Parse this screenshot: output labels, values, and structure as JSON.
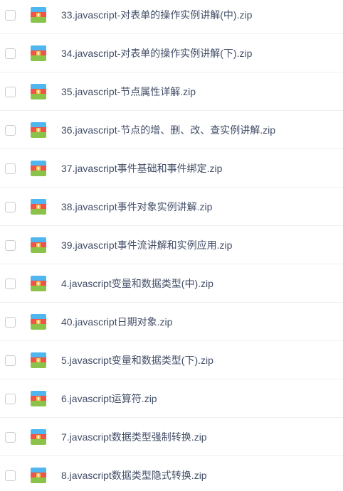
{
  "files": [
    {
      "name": "33.javascript-对表单的操作实例讲解(中).zip",
      "icon": "zip-archive-icon"
    },
    {
      "name": "34.javascript-对表单的操作实例讲解(下).zip",
      "icon": "zip-archive-icon"
    },
    {
      "name": "35.javascript-节点属性详解.zip",
      "icon": "zip-archive-icon"
    },
    {
      "name": "36.javascript-节点的增、删、改、查实例讲解.zip",
      "icon": "zip-archive-icon"
    },
    {
      "name": "37.javascript事件基础和事件绑定.zip",
      "icon": "zip-archive-icon"
    },
    {
      "name": "38.javascript事件对象实例讲解.zip",
      "icon": "zip-archive-icon"
    },
    {
      "name": "39.javascript事件流讲解和实例应用.zip",
      "icon": "zip-archive-icon"
    },
    {
      "name": "4.javascript变量和数据类型(中).zip",
      "icon": "zip-archive-icon"
    },
    {
      "name": "40.javascript日期对象.zip",
      "icon": "zip-archive-icon"
    },
    {
      "name": "5.javascript变量和数据类型(下).zip",
      "icon": "zip-archive-icon"
    },
    {
      "name": "6.javascript运算符.zip",
      "icon": "zip-archive-icon"
    },
    {
      "name": "7.javascript数据类型强制转换.zip",
      "icon": "zip-archive-icon"
    },
    {
      "name": "8.javascript数据类型隐式转换.zip",
      "icon": "zip-archive-icon"
    }
  ],
  "colors": {
    "text": "#424e67",
    "divider": "#eef0f4",
    "checkbox_border": "#c9ccd3",
    "icon_top": "#4fb6ef",
    "icon_middle": "#f0534a",
    "icon_bottom": "#8bc34a",
    "icon_clasp": "#f5c542"
  }
}
